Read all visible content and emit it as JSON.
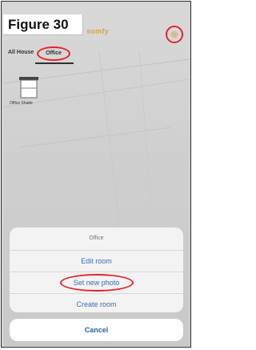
{
  "figure": {
    "label": "Figure 30"
  },
  "header": {
    "logo_text": "somfy",
    "settings_icon": "gear-icon"
  },
  "tabs": [
    {
      "label": "All House"
    },
    {
      "label": "Office"
    }
  ],
  "devices": [
    {
      "label": "Office Shade",
      "icon": "shade-icon"
    }
  ],
  "sheet": {
    "title": "Office",
    "actions": [
      {
        "label": "Edit room"
      },
      {
        "label": "Set new photo"
      },
      {
        "label": "Create room"
      }
    ],
    "cancel_label": "Cancel"
  },
  "colors": {
    "highlight": "#e3262b",
    "action_text": "#3a6fb0",
    "logo": "#d7a24a"
  }
}
